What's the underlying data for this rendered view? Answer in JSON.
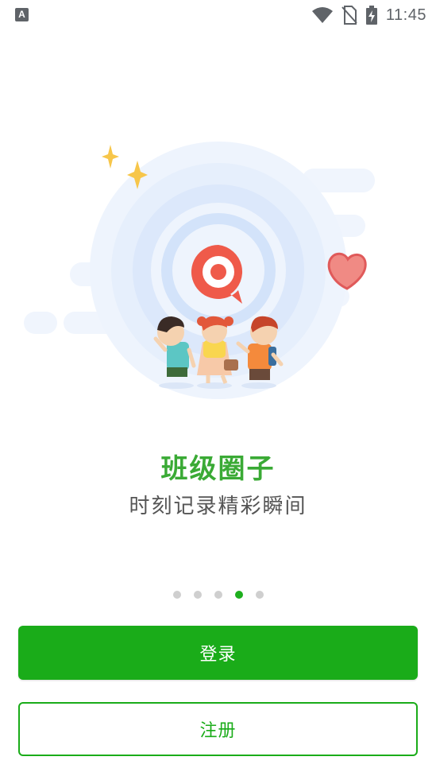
{
  "status_bar": {
    "notification_icon": "A",
    "time": "11:45",
    "icons": [
      "wifi-icon",
      "no-sim-icon",
      "battery-charging-icon"
    ]
  },
  "onboarding": {
    "title": "班级圈子",
    "subtitle": "时刻记录精彩瞬间",
    "page_indicator": {
      "total": 5,
      "current": 4
    }
  },
  "buttons": {
    "login_label": "登录",
    "register_label": "注册"
  },
  "colors": {
    "accent": "#1aac19",
    "title": "#3aaa35",
    "subtitle": "#555555",
    "dot_inactive": "#cfcfcf",
    "target_icon": "#ef5a4a"
  }
}
